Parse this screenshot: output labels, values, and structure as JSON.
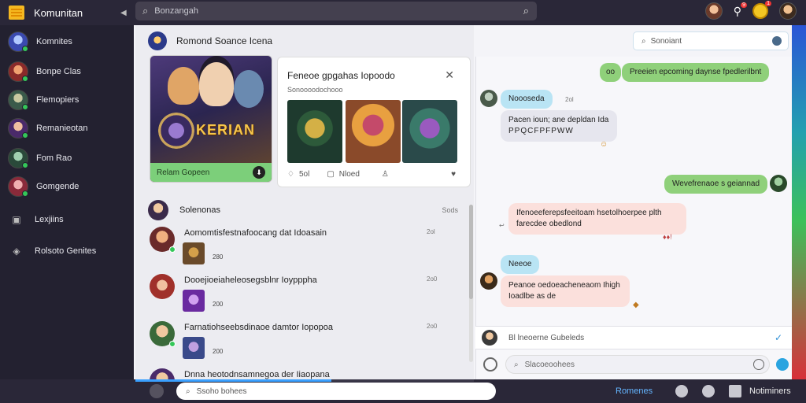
{
  "topbar": {
    "brand": "Komunitan",
    "search_placeholder": "Bonzangah",
    "icons": [
      "menu-icon",
      "search-icon",
      "search-magnifier-icon",
      "notification-icon",
      "coin-icon"
    ],
    "notif_badge": "9",
    "coin_badge": "1"
  },
  "sidebar": {
    "items": [
      {
        "label": "Komnites"
      },
      {
        "label": "Bonpe Clas"
      },
      {
        "label": "Flemopiers"
      },
      {
        "label": "Remanieotan"
      },
      {
        "label": "Fom Rao"
      },
      {
        "label": "Gomgende"
      },
      {
        "label": "Lexjiins"
      },
      {
        "label": "Rolsoto Genites"
      }
    ]
  },
  "room": {
    "title": "Romond Soance Icena"
  },
  "game_card": {
    "title": "KERIAN",
    "footer_label": "Relam Gopeen"
  },
  "popup": {
    "title": "Feneoe gpgahas Iopoodo",
    "subtitle": "Sonoooodochooo",
    "likes": "5ol",
    "reply_label": "Nloed"
  },
  "section": {
    "title": "Solenonas",
    "action": "Sods"
  },
  "feed": [
    {
      "text": "Aomomtisfestnafoocang dat Idoasain",
      "time": "2ol",
      "count": "280"
    },
    {
      "text": "Dooejioeiaheleosegsblnr Ioypppha",
      "time": "2o0",
      "count": "200"
    },
    {
      "text": "Farnatiohseebsdinaoe damtor Iopopoa",
      "time": "2o0",
      "count": "200"
    },
    {
      "text": "Dnna heotodnsamnegoa der Iiaopana",
      "time": "",
      "count": ""
    }
  ],
  "chat": {
    "search_placeholder": "Sonoiant",
    "messages": [
      {
        "text": "Preeien epcoming daynse fpedlerilbnt"
      },
      {
        "text": "Noooseda"
      },
      {
        "text": "Pacen ioun; ane depldan Ida"
      },
      {
        "text": "PPQCFPFPWW"
      },
      {
        "text": "Wevefrenaoe s geiannad"
      },
      {
        "text": "Ifenoeeferepsfeeitoam hsetolhoerpee plth"
      },
      {
        "text": "farecdee obedlond"
      },
      {
        "text": "Neeoe"
      },
      {
        "text": "Peanoe oedoeacheneaom Ihigh"
      },
      {
        "text": "Ioadlbe as de"
      }
    ],
    "small_labels": {
      "time1": "2ol",
      "time2": "2ol"
    },
    "input_row": "Bl lneoerne Gubeleds",
    "compose_placeholder": "Slacoeoohees"
  },
  "bottombar": {
    "search_placeholder": "Ssoho bohees",
    "link": "Romenes",
    "notifications": "Notiminers",
    "progress": 0.58
  },
  "colors": {
    "accent_green": "#8fd07a",
    "accent_blue": "#b9e4f4",
    "topbar": "#2a2738",
    "link": "#64b5ff"
  }
}
